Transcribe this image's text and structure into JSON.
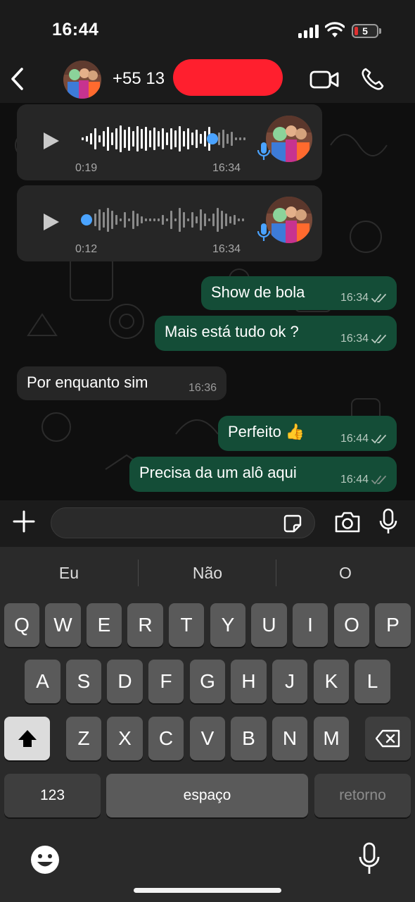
{
  "status_bar": {
    "time": "16:44",
    "battery": "5"
  },
  "header": {
    "contact_name": "+55 13"
  },
  "messages": {
    "voice_1": {
      "duration": "0:19",
      "time": "16:34"
    },
    "voice_2": {
      "duration": "0:12",
      "time": "16:34"
    },
    "m1": {
      "text": "Show de bola",
      "time": "16:34"
    },
    "m2": {
      "text": "Mais está tudo ok ?",
      "time": "16:34"
    },
    "m3": {
      "text": "Por enquanto sim",
      "time": "16:36"
    },
    "m4": {
      "text": "Perfeito 👍",
      "time": "16:44"
    },
    "m5": {
      "text": "Precisa da um alô aqui",
      "time": "16:44"
    }
  },
  "keyboard": {
    "suggestions": [
      "Eu",
      "Não",
      "O"
    ],
    "row1": [
      "Q",
      "W",
      "E",
      "R",
      "T",
      "Y",
      "U",
      "I",
      "O",
      "P"
    ],
    "row2": [
      "A",
      "S",
      "D",
      "F",
      "G",
      "H",
      "J",
      "K",
      "L"
    ],
    "row3": [
      "Z",
      "X",
      "C",
      "V",
      "B",
      "N",
      "M"
    ],
    "numbers_label": "123",
    "space_label": "espaço",
    "return_label": "retorno"
  },
  "colors": {
    "outgoing_bubble": "#144d37",
    "incoming_bubble": "#262626",
    "accent_blue": "#4aa3ff",
    "redaction": "#ff1f2e"
  },
  "icons": [
    "back-icon",
    "video-call-icon",
    "phone-icon",
    "play-icon",
    "microphone-icon",
    "plus-icon",
    "sticker-icon",
    "camera-icon",
    "emoji-icon",
    "shift-icon",
    "delete-icon",
    "read-ticks-icon"
  ]
}
